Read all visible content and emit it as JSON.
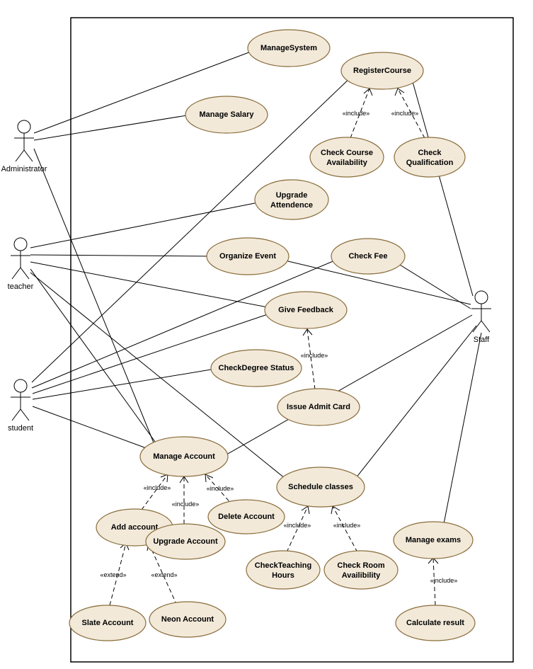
{
  "actors": {
    "administrator": {
      "label": "Administrator"
    },
    "teacher": {
      "label": "teacher"
    },
    "student": {
      "label": "student"
    },
    "staff": {
      "label": "Staff"
    }
  },
  "usecases": {
    "manageSystem": {
      "label": "ManageSystem"
    },
    "registerCourse": {
      "label": "RegisterCourse"
    },
    "manageSalary": {
      "label": "Manage Salary"
    },
    "checkCourseAvail": {
      "label1": "Check Course",
      "label2": "Availability"
    },
    "checkQualification": {
      "label1": "Check",
      "label2": "Qualification"
    },
    "upgradeAttendence": {
      "label1": "Upgrade",
      "label2": "Attendence"
    },
    "organizeEvent": {
      "label": "Organize Event"
    },
    "checkFee": {
      "label": "Check Fee"
    },
    "giveFeedback": {
      "label": "Give Feedback"
    },
    "checkDegreeStatus": {
      "label": "CheckDegree Status"
    },
    "issueAdmitCard": {
      "label": "Issue Admit Card"
    },
    "manageAccount": {
      "label": "Manage Account"
    },
    "scheduleClasses": {
      "label": "Schedule classes"
    },
    "addAccount": {
      "label": "Add account"
    },
    "upgradeAccount": {
      "label": "Upgrade Account"
    },
    "deleteAccount": {
      "label": "Delete Account"
    },
    "manageExams": {
      "label": "Manage exams"
    },
    "checkTeachingHours": {
      "label1": "CheckTeaching",
      "label2": "Hours"
    },
    "checkRoomAvail": {
      "label1": "Check Room",
      "label2": "Availibility"
    },
    "slateAccount": {
      "label": "Slate Account"
    },
    "neonAccount": {
      "label": "Neon Account"
    },
    "calculateResult": {
      "label": "Calculate result"
    }
  },
  "stereotypes": {
    "include": "«include»",
    "extend": "«extend»"
  }
}
